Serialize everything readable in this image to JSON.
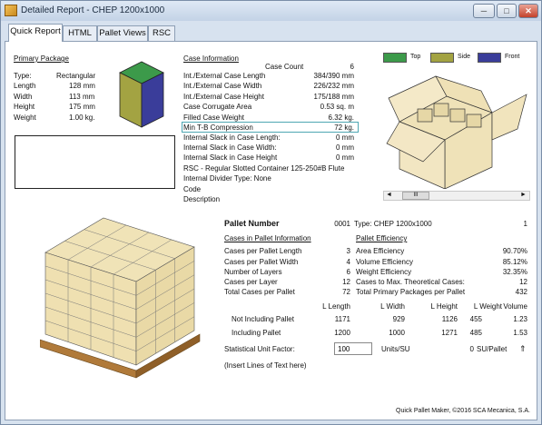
{
  "window": {
    "title": "Detailed Report - CHEP 1200x1000",
    "min": "─",
    "max": "□",
    "close": "✕"
  },
  "tabs": [
    "Quick Report",
    "HTML",
    "Pallet Views",
    "RSC"
  ],
  "primary_package": {
    "heading": "Primary Package",
    "rows": [
      {
        "label": "Type:",
        "value": "Rectangular"
      },
      {
        "label": "Length",
        "value": "128 mm"
      },
      {
        "label": "Width",
        "value": "113 mm"
      },
      {
        "label": "Height",
        "value": "175 mm"
      },
      {
        "label": "Weight",
        "value": "1.00 kg."
      }
    ]
  },
  "case": {
    "heading": "Case Information",
    "count_label": "Case Count",
    "count_value": "6",
    "rows": [
      {
        "label": "Int./External Case Length",
        "value": "384/390 mm"
      },
      {
        "label": "Int./External Case Width",
        "value": "226/232 mm"
      },
      {
        "label": "Int./External Case Height",
        "value": "175/188 mm"
      },
      {
        "label": "Case Corrugate Area",
        "value": "0.53 sq. m"
      },
      {
        "label": "Filled Case Weight",
        "value": "6.32 kg."
      },
      {
        "label": "Min T-B Compression",
        "value": "72 kg."
      },
      {
        "label": "Internal Slack in Case Length:",
        "value": "0 mm"
      },
      {
        "label": "Internal Slack in Case Width:",
        "value": "0 mm"
      },
      {
        "label": "Internal Slack in Case Height",
        "value": "0 mm"
      }
    ],
    "rsc": "RSC - Regular Slotted Container 125-250#B Flute",
    "divider": "Internal Divider Type: None",
    "code": "Code",
    "description": "Description"
  },
  "legend": {
    "top": {
      "label": "Top",
      "color": "#3c9a4a"
    },
    "side": {
      "label": "Side",
      "color": "#a3a342"
    },
    "front": {
      "label": "Front",
      "color": "#3a3d9a"
    }
  },
  "pallet": {
    "number_label": "Pallet Number",
    "number_value": "0001",
    "type_label": "Type: CHEP 1200x1000",
    "type_value": "1",
    "cases_heading": "Cases in Pallet Information",
    "eff_heading": "Pallet Efficiency",
    "cases_rows": [
      {
        "label": "Cases per Pallet Length",
        "value": "3"
      },
      {
        "label": "Cases per Pallet Width",
        "value": "4"
      },
      {
        "label": "Number of Layers",
        "value": "6"
      },
      {
        "label": "Cases per Layer",
        "value": "12"
      },
      {
        "label": "Total Cases per Pallet",
        "value": "72"
      }
    ],
    "eff_rows": [
      {
        "label": "Area Efficiency",
        "value": "90.70%"
      },
      {
        "label": "Volume Efficiency",
        "value": "85.12%"
      },
      {
        "label": "Weight Efficiency",
        "value": "32.35%"
      },
      {
        "label": "Cases to Max. Theoretical Cases:",
        "value": "12"
      },
      {
        "label": "Total Primary Packages per Pallet",
        "value": "432"
      }
    ],
    "dims_headers": [
      "L Length",
      "L Width",
      "L Height",
      "L Weight",
      "Volume"
    ],
    "dims_rows": [
      {
        "label": "Not Including Pallet",
        "values": [
          "1171",
          "929",
          "1126",
          "455",
          "1.23"
        ]
      },
      {
        "label": "Including Pallet",
        "values": [
          "1200",
          "1000",
          "1271",
          "485",
          "1.53"
        ]
      }
    ],
    "stat_label": "Statistical Unit Factor:",
    "stat_value": "100",
    "units_label": "Units/SU",
    "su_value": "0",
    "su_label": "SU/Pallet",
    "insert_text": "(Insert Lines of Text here)"
  },
  "footer": "Quick Pallet Maker, ©2016 SCA Mecanica, S.A.",
  "scroll": {
    "left": "◄",
    "right": "►",
    "thumb": "III"
  },
  "chevron": "⇑"
}
